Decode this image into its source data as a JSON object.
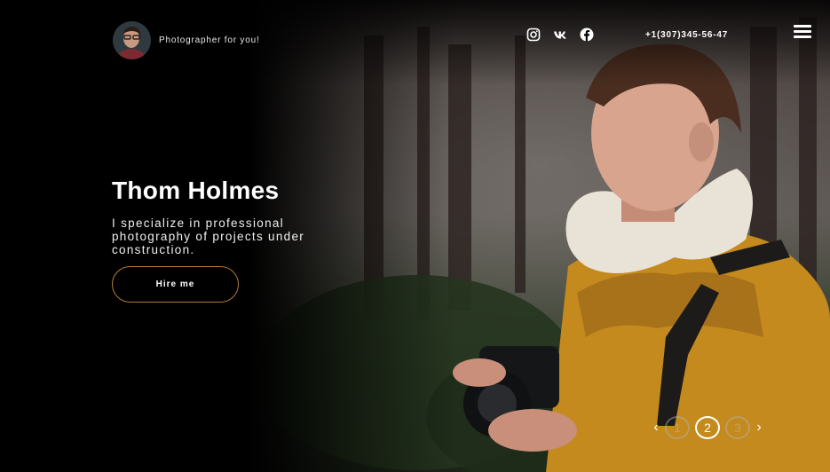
{
  "header": {
    "tagline": "Photographer for you!",
    "phone": "+1(307)345-56-47",
    "socials": [
      {
        "name": "instagram-icon"
      },
      {
        "name": "vk-icon"
      },
      {
        "name": "facebook-icon"
      }
    ]
  },
  "hero": {
    "title": "Thom Holmes",
    "description": "I specialize in professional photography of projects under construction.",
    "cta_label": "Hire me"
  },
  "pager": {
    "prev": "‹",
    "next": "›",
    "pages": [
      "1",
      "2",
      "3"
    ],
    "active_page": "2"
  },
  "colors": {
    "background": "#000000",
    "accent_border": "#b07a3a",
    "jacket": "#c48a1e"
  }
}
